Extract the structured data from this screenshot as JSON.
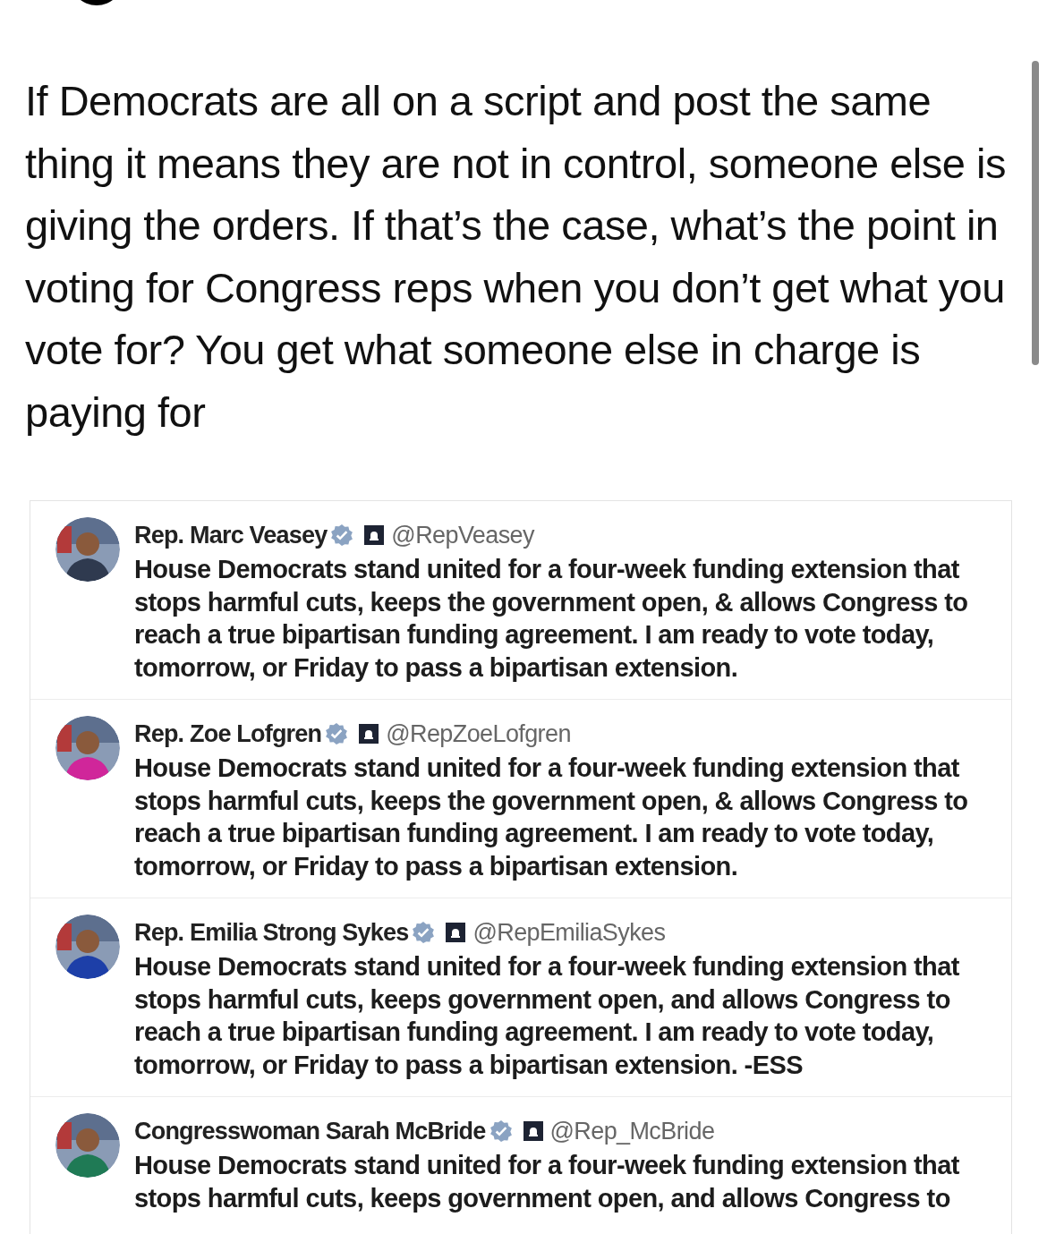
{
  "post": {
    "text": "If Democrats are all on a script and post the same thing it means they are not in control, someone else is giving the orders. If that’s the case, what’s the point in voting for Congress reps when you don’t get what you vote for? You get what someone else in charge is paying for"
  },
  "embedded_posts": [
    {
      "name": "Rep. Marc Veasey",
      "handle": "@RepVeasey",
      "text": "House Democrats stand united for a four-week funding extension that stops harmful cuts, keeps the government open, & allows Congress to reach a true bipartisan funding agreement. I am ready to vote today, tomorrow, or Friday to pass a bipartisan extension."
    },
    {
      "name": "Rep. Zoe Lofgren",
      "handle": "@RepZoeLofgren",
      "text": "House Democrats stand united for a four-week funding extension that stops harmful cuts, keeps the government open, & allows Congress to reach a true bipartisan funding agreement. I am ready to vote today, tomorrow, or Friday to pass a bipartisan extension."
    },
    {
      "name": "Rep. Emilia Strong Sykes",
      "handle": "@RepEmiliaSykes",
      "text": "House Democrats stand united for a four-week funding extension that stops harmful cuts, keeps government open, and allows Congress to reach a true bipartisan funding agreement. I am ready to vote today, tomorrow, or Friday to pass a bipartisan extension. -ESS"
    },
    {
      "name": "Congresswoman Sarah McBride",
      "handle": "@Rep_McBride",
      "text": "House Democrats stand united for a four-week funding extension that stops harmful cuts, keeps government open, and allows Congress to"
    }
  ]
}
